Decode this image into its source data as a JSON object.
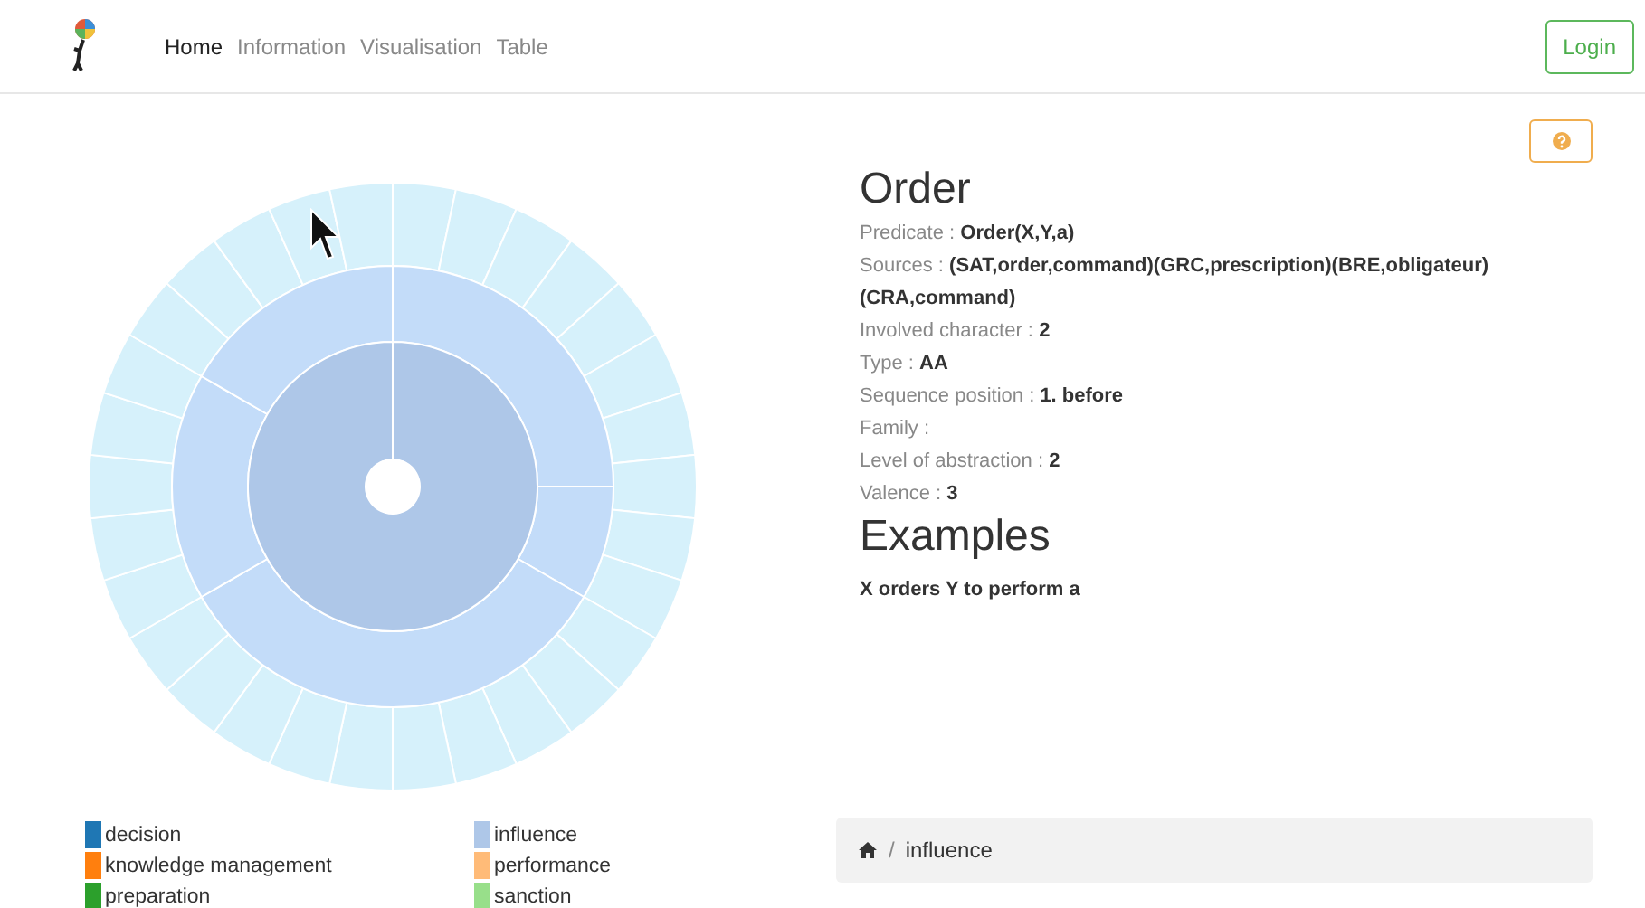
{
  "nav": {
    "items": [
      {
        "label": "Home",
        "selected": true
      },
      {
        "label": "Information",
        "selected": false
      },
      {
        "label": "Visualisation",
        "selected": false
      },
      {
        "label": "Table",
        "selected": false
      }
    ],
    "login": "Login"
  },
  "legend": [
    {
      "label": "decision",
      "color": "#1f77b4"
    },
    {
      "label": "influence",
      "color": "#aec7e8"
    },
    {
      "label": "knowledge management",
      "color": "#ff7f0e"
    },
    {
      "label": "performance",
      "color": "#ffbb78"
    },
    {
      "label": "preparation",
      "color": "#2ca02c"
    },
    {
      "label": "sanction",
      "color": "#98df8a"
    }
  ],
  "detail": {
    "title": "Order",
    "fields": [
      "Predicate : **Order(X,Y,a)**",
      "Sources : **(SAT,order,command)(GRC,prescription)(BRE,obligateur)(CRA,command)**",
      "Involved character : **2**",
      "Type : **AA**",
      "Sequence position : **1. before**",
      "Family :",
      "Level of abstraction : **2**",
      "Valence : **3**"
    ],
    "examples_title": "Examples",
    "examples": [
      "X orders Y to perform a"
    ]
  },
  "breadcrumb": {
    "separator": "/",
    "items": [
      "influence"
    ]
  }
}
